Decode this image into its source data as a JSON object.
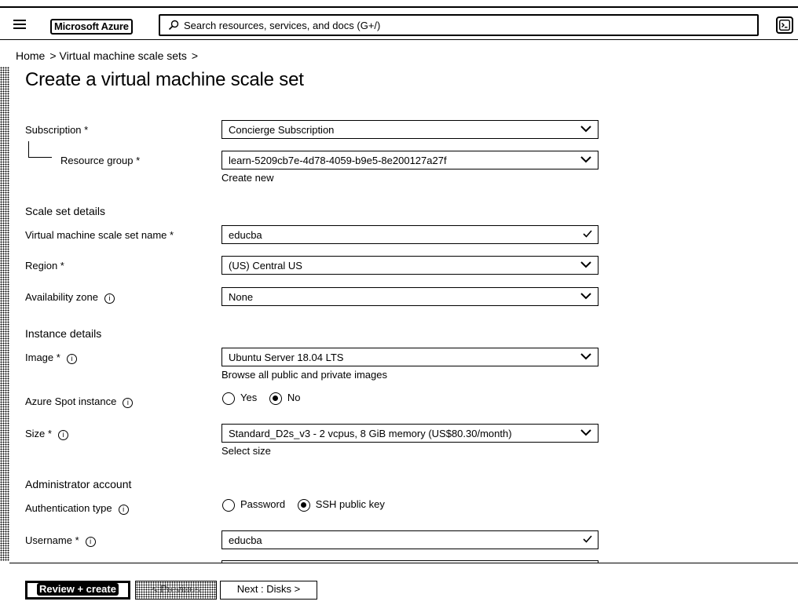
{
  "header": {
    "brand": "Microsoft Azure",
    "search_placeholder": "Search resources, services, and docs (G+/)"
  },
  "breadcrumb": [
    "Home",
    "Virtual machine scale sets"
  ],
  "page_title": "Create a virtual machine scale set",
  "form": {
    "subscription": {
      "label": "Subscription *",
      "value": "Concierge Subscription"
    },
    "resource_group": {
      "label": "Resource group *",
      "value": "learn-5209cb7e-4d78-4059-b9e5-8e200127a27f",
      "link": "Create new"
    },
    "section_scale_set": "Scale set details",
    "vmss_name": {
      "label": "Virtual machine scale set name *",
      "value": "educba"
    },
    "region": {
      "label": "Region *",
      "value": "(US) Central US"
    },
    "availability_zone": {
      "label": "Availability zone",
      "value": "None"
    },
    "section_instance": "Instance details",
    "image": {
      "label": "Image *",
      "value": "Ubuntu Server 18.04 LTS",
      "link": "Browse all public and private images"
    },
    "spot": {
      "label": "Azure Spot instance",
      "options": [
        "Yes",
        "No"
      ],
      "selected": "No"
    },
    "size": {
      "label": "Size *",
      "value": "Standard_D2s_v3 - 2 vcpus, 8 GiB memory (US$80.30/month)",
      "link": "Select size"
    },
    "section_admin": "Administrator account",
    "auth_type": {
      "label": "Authentication type",
      "options": [
        "Password",
        "SSH public key"
      ],
      "selected": "SSH public key"
    },
    "username": {
      "label": "Username *",
      "value": "educba"
    }
  },
  "footer": {
    "review_create": "Review + create",
    "previous": "< Previous",
    "next": "Next : Disks >"
  },
  "icons": {
    "menu": "hamburger-icon",
    "search": "search-icon",
    "shell": "cloud-shell-icon",
    "info": "info-icon",
    "dropdown": "chevron-down-icon",
    "valid": "checkmark-icon"
  }
}
